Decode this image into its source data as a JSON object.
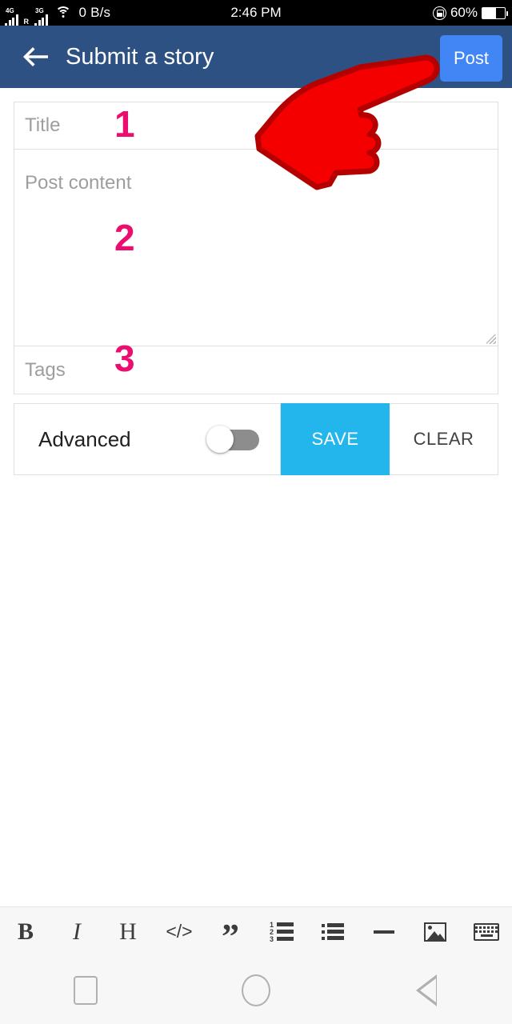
{
  "statusbar": {
    "sim1_gen": "4G",
    "sim2_gen": "3G",
    "roaming": "R",
    "network_speed": "0 B/s",
    "time": "2:46 PM",
    "battery_percent": "60%",
    "battery_level": 60,
    "wifi_icon": "wifi-icon",
    "rotation_lock_icon": "rotation-lock-icon",
    "battery_icon": "battery-icon"
  },
  "appbar": {
    "back_icon": "back-arrow-icon",
    "title": "Submit a story",
    "post_label": "Post",
    "bg_color": "#2d5182",
    "post_color": "#4285f4"
  },
  "form": {
    "title_placeholder": "Title",
    "content_placeholder": "Post content",
    "tags_placeholder": "Tags",
    "title_value": "",
    "content_value": "",
    "tags_value": "",
    "annotations": [
      "1",
      "2",
      "3"
    ],
    "annotation_color": "#ec0e6e"
  },
  "advanced": {
    "label": "Advanced",
    "toggle_state": "off",
    "save_label": "SAVE",
    "clear_label": "CLEAR",
    "save_color": "#23b6ed"
  },
  "cursor": {
    "icon": "pointing-hand-cursor",
    "color": "#f50000",
    "outline_color": "#b50000"
  },
  "toolbar": {
    "items": [
      {
        "name": "bold-icon",
        "glyph": "B"
      },
      {
        "name": "italic-icon",
        "glyph": "I"
      },
      {
        "name": "heading-icon",
        "glyph": "H"
      },
      {
        "name": "code-icon",
        "glyph": "</>"
      },
      {
        "name": "quote-icon",
        "glyph": "”"
      },
      {
        "name": "ordered-list-icon",
        "glyph": ""
      },
      {
        "name": "bullet-list-icon",
        "glyph": ""
      },
      {
        "name": "horizontal-rule-icon",
        "glyph": ""
      },
      {
        "name": "image-icon",
        "glyph": ""
      },
      {
        "name": "keyboard-icon",
        "glyph": ""
      }
    ],
    "ordered_numbers": [
      "1",
      "2",
      "3"
    ]
  },
  "navbar": {
    "recents_icon": "recents-square-icon",
    "home_icon": "home-circle-icon",
    "back_icon": "back-triangle-icon"
  }
}
